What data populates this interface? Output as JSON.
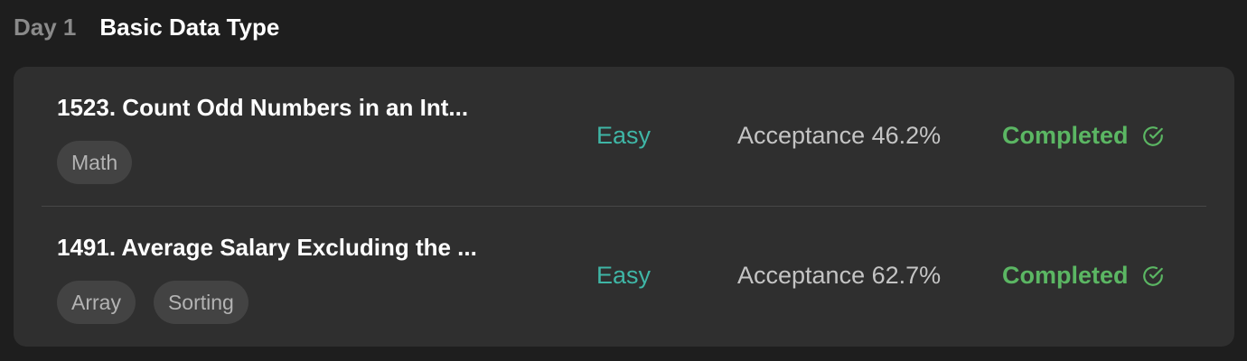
{
  "header": {
    "day": "Day 1",
    "title": "Basic Data Type"
  },
  "problems": [
    {
      "title": "1523. Count Odd Numbers in an Int...",
      "tags": [
        "Math"
      ],
      "difficulty": "Easy",
      "acceptance": "Acceptance 46.2%",
      "status": "Completed"
    },
    {
      "title": "1491. Average Salary Excluding the ...",
      "tags": [
        "Array",
        "Sorting"
      ],
      "difficulty": "Easy",
      "acceptance": "Acceptance 62.7%",
      "status": "Completed"
    }
  ],
  "colors": {
    "background": "#1e1e1e",
    "card": "#2f2f2f",
    "easy": "#3fb6a6",
    "completed": "#5bb663"
  },
  "icons": {
    "status": "check-circle-icon"
  }
}
